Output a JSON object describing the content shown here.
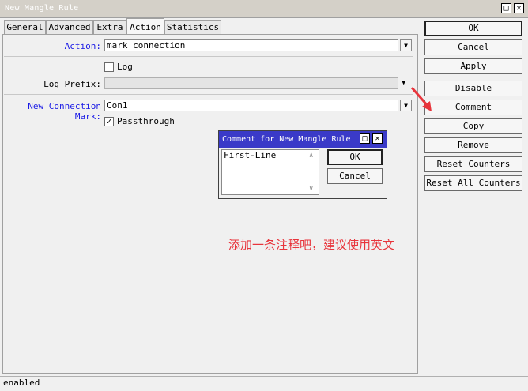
{
  "window": {
    "title": "New Mangle Rule",
    "maximize_icon": "maximize-icon",
    "close_icon": "close-icon"
  },
  "tabs": [
    {
      "label": "General"
    },
    {
      "label": "Advanced"
    },
    {
      "label": "Extra"
    },
    {
      "label": "Action",
      "active": true
    },
    {
      "label": "Statistics"
    }
  ],
  "form": {
    "action_label": "Action:",
    "action_value": "mark connection",
    "log_label": "Log",
    "log_checked": false,
    "log_prefix_label": "Log Prefix:",
    "log_prefix_value": "",
    "new_connection_mark_label": "New Connection Mark:",
    "new_connection_mark_value": "Con1",
    "passthrough_label": "Passthrough",
    "passthrough_checked": true
  },
  "side_buttons": {
    "ok": "OK",
    "cancel": "Cancel",
    "apply": "Apply",
    "disable": "Disable",
    "comment": "Comment",
    "copy": "Copy",
    "remove": "Remove",
    "reset_counters": "Reset Counters",
    "reset_all_counters": "Reset All Counters"
  },
  "dialog": {
    "title": "Comment for New Mangle Rule",
    "comment_text": "First-Line",
    "ok_label": "OK",
    "cancel_label": "Cancel"
  },
  "annotation": {
    "text": "添加一条注释吧，建议使用英文",
    "color": "#e8343b"
  },
  "status": {
    "state": "enabled"
  },
  "colors": {
    "label_blue": "#1a1ae6",
    "dialog_title_bg": "#3a3ac8",
    "annotation_red": "#e8343b"
  }
}
